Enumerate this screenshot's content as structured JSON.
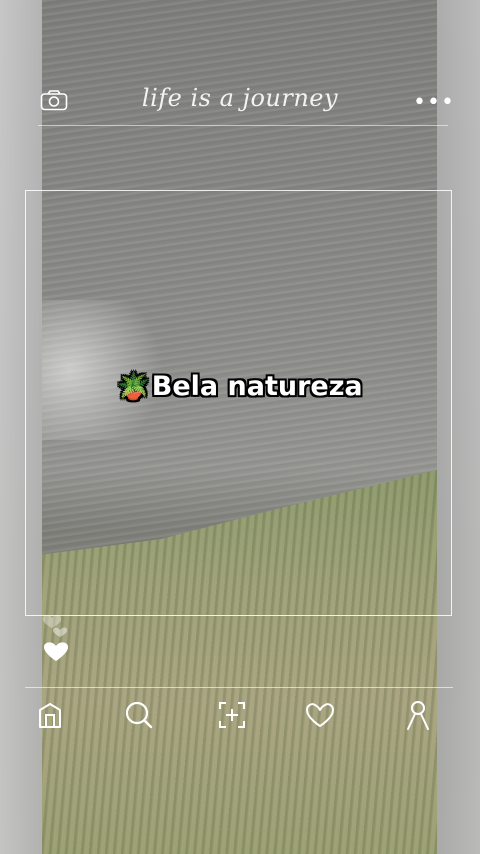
{
  "header": {
    "title": "life is a journey",
    "menu_label": "•••"
  },
  "post": {
    "caption_emoji": "🪴",
    "caption_text": "Bela natureza"
  },
  "icons": {
    "camera": "camera-icon",
    "menu": "more-dots-icon",
    "heart": "heart-icon",
    "nav": [
      "home-icon",
      "search-icon",
      "add-post-icon",
      "likes-icon",
      "profile-icon"
    ]
  },
  "colors": {
    "overlay_white": "#ffffff",
    "caption_outline": "#000000"
  }
}
